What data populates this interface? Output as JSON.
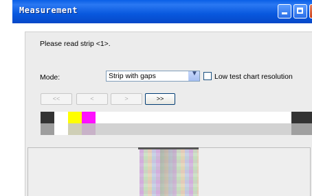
{
  "window": {
    "title": "Measurement"
  },
  "instructions": {
    "prompt": "Please read strip <1>."
  },
  "mode": {
    "label": "Mode:",
    "selected": "Strip with gaps",
    "low_res_label": "Low test chart resolution",
    "low_res_checked": false
  },
  "nav": {
    "first": "<<",
    "prev": "<",
    "next": ">",
    "last": ">>"
  },
  "strip": {
    "top_row": [
      {
        "color": "#333333",
        "w": 20
      },
      {
        "color": "#ffffff",
        "w": 20
      },
      {
        "color": "#ffff00",
        "w": 20
      },
      {
        "color": "#ff10ff",
        "w": 20
      },
      {
        "color": "#ffffff",
        "w": 285
      },
      {
        "color": "#333333",
        "w": 35
      }
    ],
    "bottom_row": [
      {
        "color": "#9e9e9e",
        "w": 20
      },
      {
        "color": "#ffffff",
        "w": 20
      },
      {
        "color": "#cfcfb6",
        "w": 20
      },
      {
        "color": "#c8b2c8",
        "w": 20
      },
      {
        "color": "#d2d2d2",
        "w": 285
      },
      {
        "color": "#a0a0a0",
        "w": 35
      }
    ]
  }
}
